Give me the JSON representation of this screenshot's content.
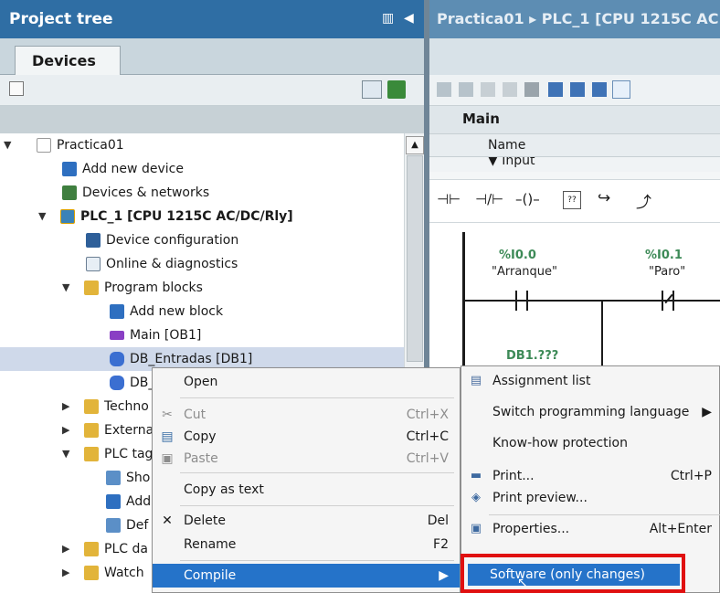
{
  "project_tree": {
    "title": "Project tree",
    "tab": "Devices"
  },
  "tree_items": [
    {
      "label": "Practica01"
    },
    {
      "label": "Add new device"
    },
    {
      "label": "Devices & networks"
    },
    {
      "label": "PLC_1 [CPU 1215C AC/DC/Rly]"
    },
    {
      "label": "Device configuration"
    },
    {
      "label": "Online & diagnostics"
    },
    {
      "label": "Program blocks"
    },
    {
      "label": "Add new block"
    },
    {
      "label": "Main [OB1]"
    },
    {
      "label": "DB_Entradas [DB1]"
    },
    {
      "label": "DB_"
    },
    {
      "label": "Techno"
    },
    {
      "label": "Externa"
    },
    {
      "label": "PLC tag"
    },
    {
      "label": "Sho"
    },
    {
      "label": "Add"
    },
    {
      "label": "Def"
    },
    {
      "label": "PLC da"
    },
    {
      "label": "Watch"
    }
  ],
  "editor": {
    "breadcrumb": "Practica01 ▸ PLC_1 [CPU 1215C AC",
    "block_title": "Main",
    "col_name": "Name",
    "row_input": "▼  Input",
    "contacts": [
      {
        "addr": "%I0.0",
        "name": "\"Arranque\""
      },
      {
        "addr": "%I0.1",
        "name": "\"Paro\""
      }
    ],
    "db_ref": "DB1.???"
  },
  "context_menu": {
    "open": "Open",
    "cut": "Cut",
    "cut_key": "Ctrl+X",
    "copy": "Copy",
    "copy_key": "Ctrl+C",
    "paste": "Paste",
    "paste_key": "Ctrl+V",
    "copy_as_text": "Copy as text",
    "delete": "Delete",
    "delete_key": "Del",
    "rename": "Rename",
    "rename_key": "F2",
    "compile": "Compile"
  },
  "submenu": {
    "assignment_list": "Assignment list",
    "switch_lang": "Switch programming language",
    "knowhow": "Know-how protection",
    "print": "Print...",
    "print_key": "Ctrl+P",
    "print_preview": "Print preview...",
    "properties": "Properties...",
    "properties_key": "Alt+Enter",
    "software": "Software (only changes)"
  },
  "colors": {
    "header_blue": "#2f6ea4",
    "menu_highlight": "#2573c9",
    "highlight_box": "#e01010",
    "tag_green": "#3d8a57"
  }
}
